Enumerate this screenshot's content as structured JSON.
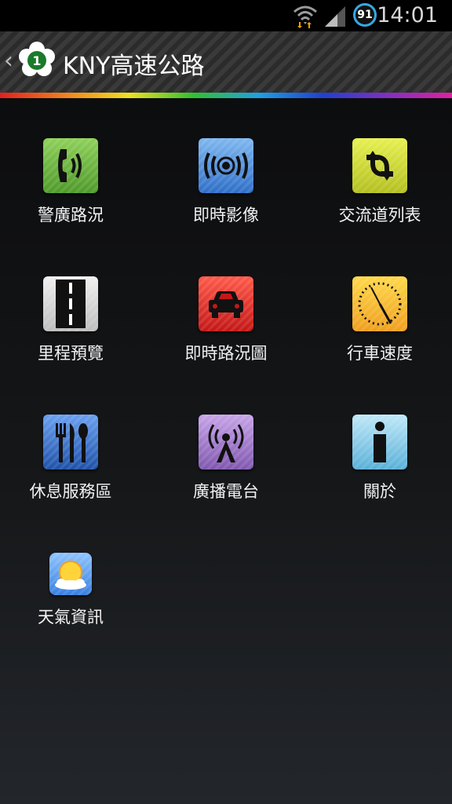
{
  "status_bar": {
    "time": "14:01",
    "battery_level": "91",
    "icons": [
      "wifi-icon",
      "signal-icon",
      "battery-icon"
    ]
  },
  "action_bar": {
    "title": "KNY高速公路",
    "logo_text": "1",
    "back_glyph": "‹"
  },
  "menu": {
    "items": [
      {
        "label": "警廣路況",
        "icon": "phone-icon"
      },
      {
        "label": "即時影像",
        "icon": "broadcast-waves-icon"
      },
      {
        "label": "交流道列表",
        "icon": "interchange-arrows-icon"
      },
      {
        "label": "里程預覽",
        "icon": "road-icon"
      },
      {
        "label": "即時路況圖",
        "icon": "car-icon"
      },
      {
        "label": "行車速度",
        "icon": "speedometer-icon"
      },
      {
        "label": "休息服務區",
        "icon": "fork-knife-spoon-icon"
      },
      {
        "label": "廣播電台",
        "icon": "radio-tower-icon"
      },
      {
        "label": "關於",
        "icon": "info-icon"
      },
      {
        "label": "天氣資訊",
        "icon": "weather-sun-cloud-icon"
      }
    ]
  }
}
